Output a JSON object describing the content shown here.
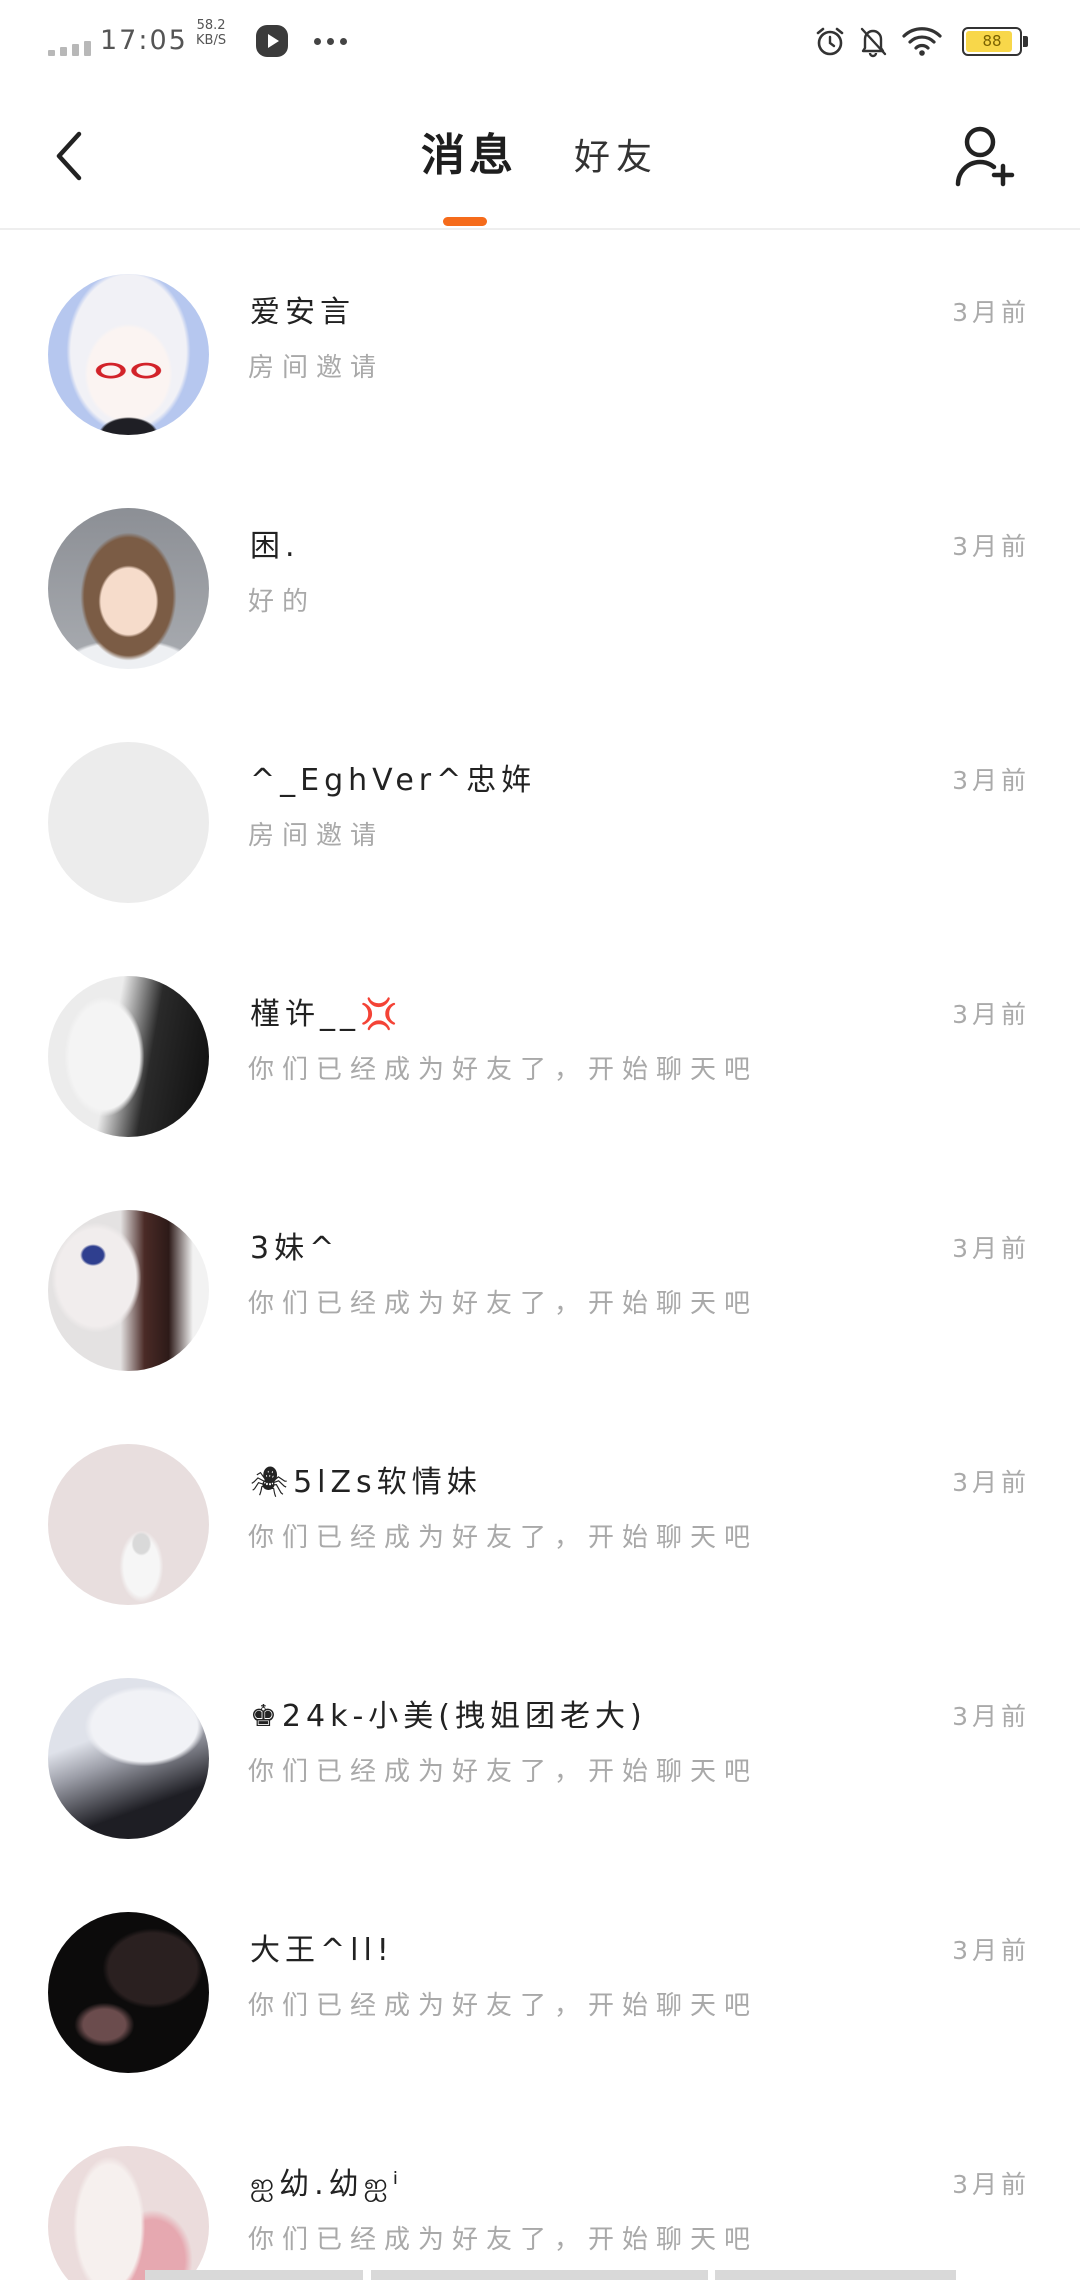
{
  "status_bar": {
    "time": "17:05",
    "net_speed_value": "58.2",
    "net_speed_unit": "KB/S",
    "battery_level": "88",
    "icons": [
      "signal-icon",
      "media-play-icon",
      "more-notifications-icon",
      "alarm-icon",
      "notifications-muted-icon",
      "wifi-icon",
      "battery-icon"
    ]
  },
  "header": {
    "back_icon": "back-arrow-icon",
    "tabs": [
      {
        "label": "消息",
        "active": true
      },
      {
        "label": "好友",
        "active": false
      }
    ],
    "add_friend_icon": "add-friend-icon"
  },
  "colors": {
    "accent": "#f56b1b",
    "text_primary": "#222222",
    "text_secondary": "#a9a9a9",
    "battery_fill": "#f8d74a"
  },
  "messages": [
    {
      "name": "爱安言",
      "preview": "房间邀请",
      "time": "3月前"
    },
    {
      "name": "困.",
      "preview": "好的",
      "time": "3月前"
    },
    {
      "name": "^_EghVer^忠姩",
      "preview": "房间邀请",
      "time": "3月前"
    },
    {
      "name": "槿许__💢",
      "preview": "你们已经成为好友了，开始聊天吧",
      "time": "3月前"
    },
    {
      "name": "3妹^",
      "preview": "你们已经成为好友了，开始聊天吧",
      "time": "3月前"
    },
    {
      "name": "🕷5lZs软情妹",
      "preview": "你们已经成为好友了，开始聊天吧",
      "time": "3月前"
    },
    {
      "name": "♚24k-小美(拽姐团老大)",
      "preview": "你们已经成为好友了，开始聊天吧",
      "time": "3月前"
    },
    {
      "name": "大王^ll!",
      "preview": "你们已经成为好友了，开始聊天吧",
      "time": "3月前"
    },
    {
      "name": "ஐ幼.幼ஐⁱ",
      "preview": "你们已经成为好友了，开始聊天吧",
      "time": "3月前"
    }
  ]
}
